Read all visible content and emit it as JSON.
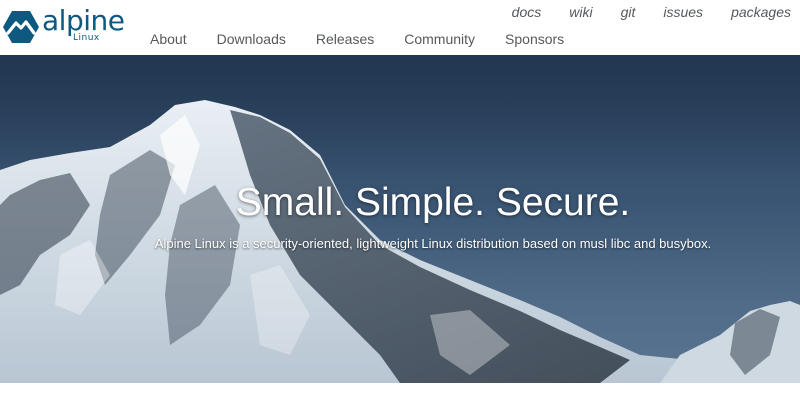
{
  "brand": {
    "name": "alpine",
    "subname": "Linux",
    "color": "#0d597f"
  },
  "secondary_nav": [
    {
      "label": "docs"
    },
    {
      "label": "wiki"
    },
    {
      "label": "git"
    },
    {
      "label": "issues"
    },
    {
      "label": "packages"
    }
  ],
  "primary_nav": [
    {
      "label": "About"
    },
    {
      "label": "Downloads"
    },
    {
      "label": "Releases"
    },
    {
      "label": "Community"
    },
    {
      "label": "Sponsors"
    }
  ],
  "hero": {
    "title": "Small. Simple. Secure.",
    "subtitle": "Alpine Linux is a security-oriented, lightweight Linux distribution based on musl libc and busybox."
  }
}
